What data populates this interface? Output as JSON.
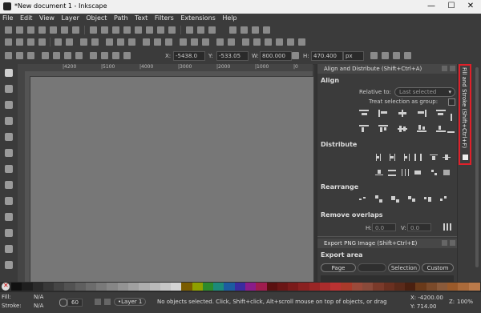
{
  "window": {
    "title": "*New document 1 - Inkscape",
    "minimize": "—",
    "maximize": "☐",
    "close": "✕"
  },
  "menu": [
    "File",
    "Edit",
    "View",
    "Layer",
    "Object",
    "Path",
    "Text",
    "Filters",
    "Extensions",
    "Help"
  ],
  "controls": {
    "x_label": "X:",
    "x_value": "-5438.0",
    "y_label": "Y:",
    "y_value": "-533.05",
    "w_label": "W:",
    "w_value": "800.000",
    "h_label": "H:",
    "h_value": "470.400",
    "unit": "px"
  },
  "ruler": {
    "labels": [
      "|4200",
      "|5100",
      "|4000",
      "|3000",
      "|2000",
      "|1000",
      "|0"
    ]
  },
  "panel": {
    "align_header": "Align and Distribute (Shift+Ctrl+A)",
    "align_section": "Align",
    "relative_to_label": "Relative to:",
    "relative_to_value": "Last selected",
    "treat_selection": "Treat selection as group:",
    "distribute_section": "Distribute",
    "rearrange_section": "Rearrange",
    "remove_overlaps_section": "Remove overlaps",
    "h_label": "H:",
    "h_value": "0.0",
    "v_label": "V:",
    "v_value": "0.0",
    "export_header": "Export PNG Image (Shift+Ctrl+E)",
    "export_area_section": "Export area",
    "page_btn": "Page",
    "selection_btn": "Selection",
    "custom_btn": "Custom"
  },
  "dock": {
    "fill_stroke_tab": "Fill and Stroke (Shift+Ctrl+F)"
  },
  "colors": {
    "highlight": "#e0202a",
    "palette": [
      "#111111",
      "#1e1e1e",
      "#2b2b2b",
      "#383838",
      "#454545",
      "#525252",
      "#5f5f5f",
      "#6c6c6c",
      "#797979",
      "#868686",
      "#939393",
      "#a0a0a0",
      "#adadad",
      "#bababa",
      "#c7c7c7",
      "#d4d4d4",
      "#7a5c00",
      "#8fa000",
      "#2c8a2c",
      "#1c8a7a",
      "#1c5ca0",
      "#3a2ca0",
      "#8a1c8a",
      "#a01c4e",
      "#5a1010",
      "#6a1515",
      "#7a1a1a",
      "#8a2020",
      "#9a2626",
      "#aa2c2c",
      "#ba3232",
      "#aa3a2a",
      "#9a4a3a",
      "#8a4a3a",
      "#7a3a2a",
      "#6a3020",
      "#5a2a1a",
      "#4a2010",
      "#6a3a1a",
      "#7a4a2a",
      "#8a5a3a",
      "#9a5a2a",
      "#aa6a3a",
      "#ba7a4a"
    ]
  },
  "status": {
    "fill_label": "Fill:",
    "fill_value": "N/A",
    "stroke_label": "Stroke:",
    "stroke_value": "N/A",
    "opacity_value": "60",
    "layer": "•Layer 1",
    "message": "No objects selected. Click, Shift+click, Alt+scroll mouse on top of objects, or drag",
    "x_readout": "X: -4200.00",
    "y_readout": "Y: 714.00",
    "z_label": "Z:",
    "zoom": "100%"
  }
}
